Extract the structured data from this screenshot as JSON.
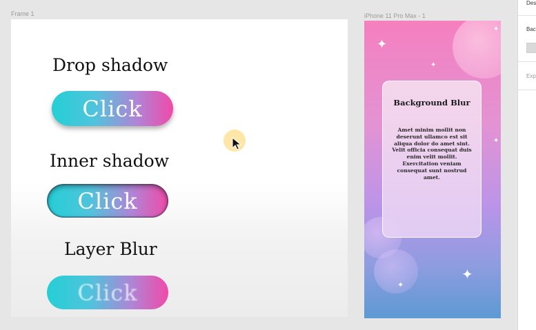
{
  "canvas": {
    "frame1_label": "Frame 1",
    "iphone_label": "iPhone 11 Pro Max - 1"
  },
  "frame1": {
    "drop_shadow_heading": "Drop shadow",
    "inner_shadow_heading": "Inner shadow",
    "layer_blur_heading": "Layer Blur",
    "button_label": "Click"
  },
  "iphone": {
    "card_title": "Background Blur",
    "card_body": "Amet minim mollit non deserunt ullamco est sit aliqua dolor do amet sint. Velit officia consequat duis enim velit mollit. Exercitation veniam consequat sunt nostrud amet."
  },
  "right_panel": {
    "design_tab": "Des",
    "background_label": "Bac",
    "export_label": "Exp"
  },
  "colors": {
    "button_gradient_start": "#24cfd6",
    "button_gradient_end": "#f04aa8",
    "phone_gradient_top": "#f57fbf",
    "phone_gradient_bottom": "#5d9ad3"
  }
}
